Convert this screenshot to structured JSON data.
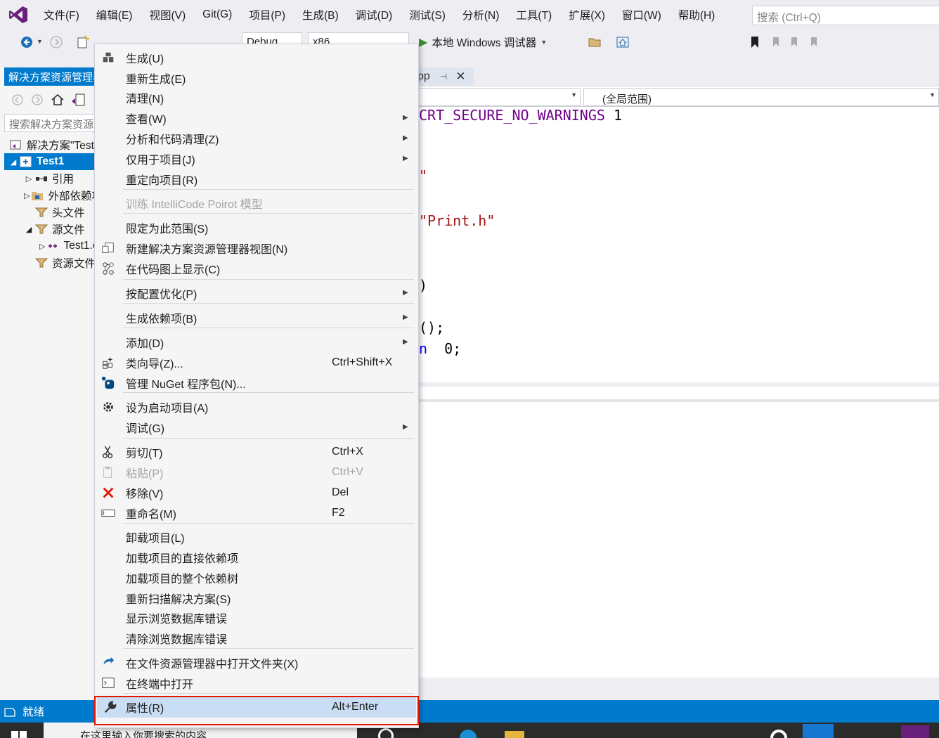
{
  "menubar": {
    "items": [
      "文件(F)",
      "编辑(E)",
      "视图(V)",
      "Git(G)",
      "项目(P)",
      "生成(B)",
      "调试(D)",
      "测试(S)",
      "分析(N)",
      "工具(T)",
      "扩展(X)",
      "窗口(W)",
      "帮助(H)"
    ],
    "search_placeholder": "搜索 (Ctrl+Q)"
  },
  "toolbar": {
    "config": "Debug",
    "platform": "x86",
    "debugger": "本地 Windows 调试器"
  },
  "solution_explorer": {
    "title": "解决方案资源管理器",
    "search_placeholder": "搜索解决方案资源管理器",
    "tree": [
      {
        "label": "解决方案\"Test1\"",
        "caret": "",
        "indent": 0,
        "icon": "solution-icon"
      },
      {
        "label": "Test1",
        "caret": "◢",
        "indent": 0,
        "icon": "project-icon",
        "selected": true
      },
      {
        "label": "引用",
        "caret": "▷",
        "indent": 1,
        "icon": "references-icon"
      },
      {
        "label": "外部依赖项",
        "caret": "▷",
        "indent": 1,
        "icon": "external-deps-icon"
      },
      {
        "label": "头文件",
        "caret": "",
        "indent": 1,
        "icon": "folder-filter-icon"
      },
      {
        "label": "源文件",
        "caret": "◢",
        "indent": 1,
        "icon": "folder-filter-icon"
      },
      {
        "label": "Test1.cpp",
        "caret": "▷",
        "indent": 2,
        "icon": "cpp-file-icon"
      },
      {
        "label": "资源文件",
        "caret": "",
        "indent": 1,
        "icon": "folder-filter-icon"
      }
    ]
  },
  "editor": {
    "tab_label": "pp",
    "scope_combo": "(全局范围)",
    "code_lines": [
      {
        "text": "CRT_SECURE_NO_WARNINGS 1",
        "color": "#6f008a"
      },
      {
        "text": "\"",
        "color": "#a31515"
      },
      {
        "text": "\"Print.h\"",
        "color": "#a31515"
      },
      {
        "text": ")",
        "color": "#000000"
      },
      {
        "text": "();",
        "color": "#000000"
      },
      {
        "text": "n  0;",
        "color": "#000000"
      }
    ]
  },
  "context_menu": {
    "items": [
      {
        "label": "生成(U)",
        "shortcut": "",
        "arrow": false,
        "icon": "build-icon"
      },
      {
        "label": "重新生成(E)",
        "shortcut": "",
        "arrow": false,
        "icon": ""
      },
      {
        "label": "清理(N)",
        "shortcut": "",
        "arrow": false,
        "icon": ""
      },
      {
        "label": "查看(W)",
        "shortcut": "",
        "arrow": true,
        "icon": ""
      },
      {
        "label": "分析和代码清理(Z)",
        "shortcut": "",
        "arrow": true,
        "icon": ""
      },
      {
        "label": "仅用于项目(J)",
        "shortcut": "",
        "arrow": true,
        "icon": ""
      },
      {
        "label": "重定向项目(R)",
        "shortcut": "",
        "arrow": false,
        "icon": ""
      },
      {
        "label": "训练 IntelliCode Poirot 模型",
        "shortcut": "",
        "arrow": false,
        "icon": "",
        "disabled": true
      },
      {
        "label": "限定为此范围(S)",
        "shortcut": "",
        "arrow": false,
        "icon": ""
      },
      {
        "label": "新建解决方案资源管理器视图(N)",
        "shortcut": "",
        "arrow": false,
        "icon": "new-view-icon"
      },
      {
        "label": "在代码图上显示(C)",
        "shortcut": "",
        "arrow": false,
        "icon": "code-map-icon"
      },
      {
        "label": "按配置优化(P)",
        "shortcut": "",
        "arrow": true,
        "icon": ""
      },
      {
        "label": "生成依赖项(B)",
        "shortcut": "",
        "arrow": true,
        "icon": ""
      },
      {
        "label": "添加(D)",
        "shortcut": "",
        "arrow": true,
        "icon": ""
      },
      {
        "label": "类向导(Z)...",
        "shortcut": "Ctrl+Shift+X",
        "arrow": false,
        "icon": "class-wizard-icon"
      },
      {
        "label": "管理 NuGet 程序包(N)...",
        "shortcut": "",
        "arrow": false,
        "icon": "nuget-icon"
      },
      {
        "label": "设为启动项目(A)",
        "shortcut": "",
        "arrow": false,
        "icon": "gear-icon"
      },
      {
        "label": "调试(G)",
        "shortcut": "",
        "arrow": true,
        "icon": ""
      },
      {
        "label": "剪切(T)",
        "shortcut": "Ctrl+X",
        "arrow": false,
        "icon": "scissors-icon"
      },
      {
        "label": "粘贴(P)",
        "shortcut": "Ctrl+V",
        "arrow": false,
        "icon": "paste-icon",
        "disabled": true
      },
      {
        "label": "移除(V)",
        "shortcut": "Del",
        "arrow": false,
        "icon": "remove-icon"
      },
      {
        "label": "重命名(M)",
        "shortcut": "F2",
        "arrow": false,
        "icon": "rename-icon"
      },
      {
        "label": "卸载项目(L)",
        "shortcut": "",
        "arrow": false,
        "icon": ""
      },
      {
        "label": "加载项目的直接依赖项",
        "shortcut": "",
        "arrow": false,
        "icon": ""
      },
      {
        "label": "加载项目的整个依赖树",
        "shortcut": "",
        "arrow": false,
        "icon": ""
      },
      {
        "label": "重新扫描解决方案(S)",
        "shortcut": "",
        "arrow": false,
        "icon": ""
      },
      {
        "label": "显示浏览数据库错误",
        "shortcut": "",
        "arrow": false,
        "icon": ""
      },
      {
        "label": "清除浏览数据库错误",
        "shortcut": "",
        "arrow": false,
        "icon": ""
      },
      {
        "label": "在文件资源管理器中打开文件夹(X)",
        "shortcut": "",
        "arrow": false,
        "icon": "open-folder-icon"
      },
      {
        "label": "在终端中打开",
        "shortcut": "",
        "arrow": false,
        "icon": "terminal-icon"
      },
      {
        "label": "属性(R)",
        "shortcut": "Alt+Enter",
        "arrow": false,
        "icon": "wrench-icon",
        "highlight": true
      }
    ]
  },
  "statusbar": {
    "text": "就绪"
  },
  "taskbar": {
    "search_text": "在这里输入你要搜索的内容"
  },
  "colors": {
    "accent": "#007acc",
    "menu_highlight": "#c9def5",
    "annotation_red": "#e51400"
  }
}
